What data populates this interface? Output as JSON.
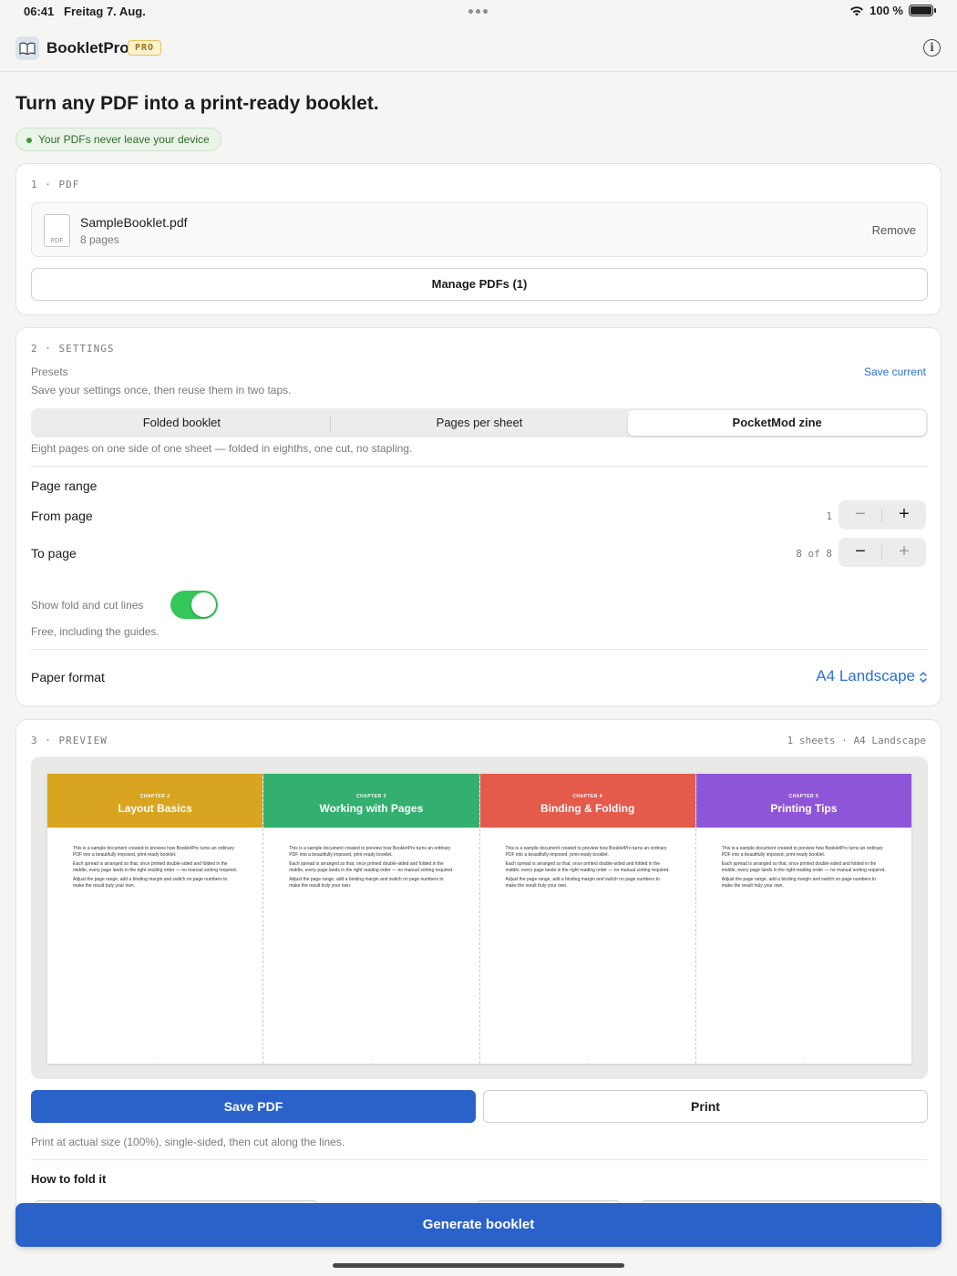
{
  "status_bar": {
    "time": "06:41",
    "date": "Freitag 7. Aug.",
    "battery": "100 %"
  },
  "app": {
    "title": "BookletPro",
    "badge": "PRO"
  },
  "headline": "Turn any PDF into a print-ready booklet.",
  "privacy_note": "Your PDFs never leave your device",
  "pdf_section": {
    "label": "1 · PDF",
    "file_name": "SampleBooklet.pdf",
    "file_meta": "8 pages",
    "file_icon_text": "PDF",
    "remove_label": "Remove",
    "manage_label": "Manage PDFs (1)"
  },
  "settings_section": {
    "label": "2 · SETTINGS",
    "presets_label": "Presets",
    "save_current": "Save current",
    "presets_hint": "Save your settings once, then reuse them in two taps.",
    "modes": [
      {
        "label": "Folded booklet",
        "selected": false
      },
      {
        "label": "Pages per sheet",
        "selected": false
      },
      {
        "label": "PocketMod zine",
        "selected": true
      }
    ],
    "mode_hint": "Eight pages on one side of one sheet — folded in eighths, one cut, no stapling.",
    "page_range_label": "Page range",
    "from_label": "From page",
    "from_value": "1",
    "to_label": "To page",
    "to_value": "8 of 8",
    "guides_label": "Show fold and cut lines",
    "guides_on": true,
    "guides_hint": "Free, including the guides.",
    "format_label": "Paper format",
    "format_value": "A4 Landscape"
  },
  "preview_section": {
    "label": "3 · PREVIEW",
    "meta": "1 sheets · A4 Landscape",
    "pages": [
      {
        "chapter": "CHAPTER 2",
        "title": "Layout Basics",
        "color": "#d9a520"
      },
      {
        "chapter": "CHAPTER 3",
        "title": "Working with Pages",
        "color": "#33b06f"
      },
      {
        "chapter": "CHAPTER 4",
        "title": "Binding & Folding",
        "color": "#e45a4b"
      },
      {
        "chapter": "CHAPTER 5",
        "title": "Printing Tips",
        "color": "#8f55d8"
      }
    ],
    "page_body": [
      "This is a sample document created to preview how BookletPro turns an ordinary PDF into a beautifully imposed, print-ready booklet.",
      "Each spread is arranged so that, once printed double-sided and folded in the middle, every page lands in the right reading order — no manual sorting required.",
      "Adjust the page range, add a binding margin and switch on page numbers to make the result truly your own."
    ],
    "save_pdf": "Save PDF",
    "print": "Print",
    "print_hint": "Print at actual size (100%), single-sided, then cut along the lines.",
    "how_to_fold": "How to fold it"
  },
  "generate_label": "Generate booklet",
  "colors": {
    "accent": "#2a62c9",
    "toggle_on": "#34c759",
    "link": "#2a6fd6"
  }
}
